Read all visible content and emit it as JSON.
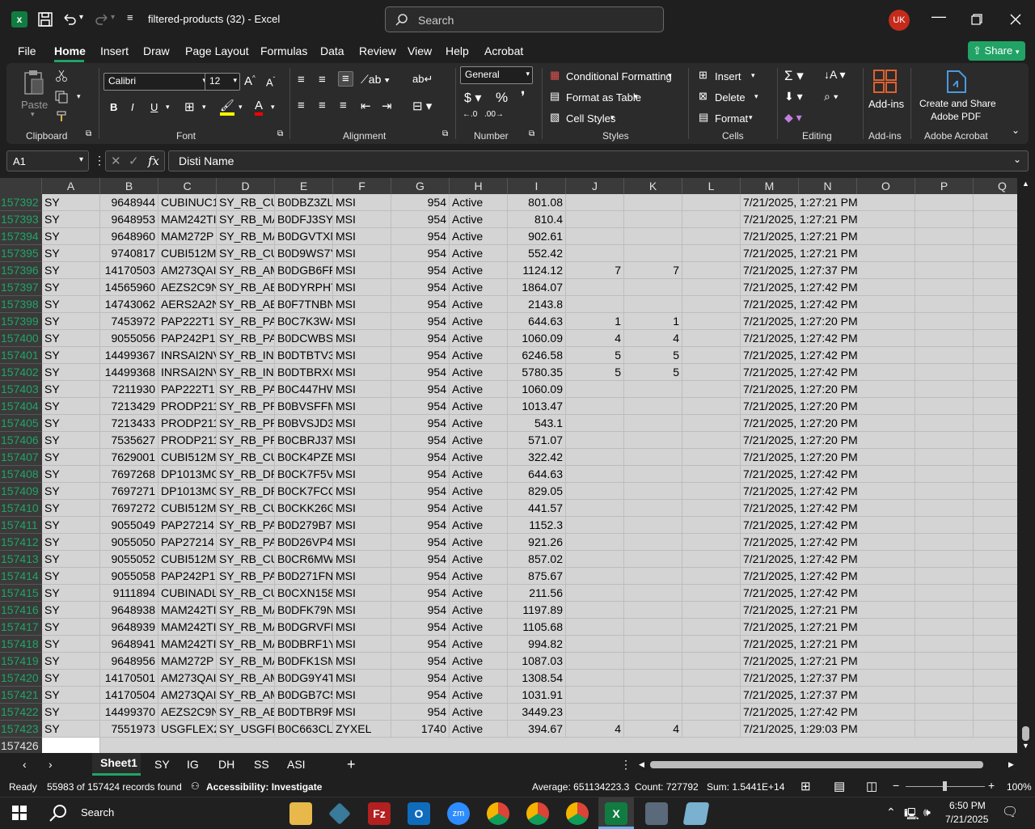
{
  "title_bar": {
    "doc_title": "filtered-products (32)  -  Excel",
    "search_placeholder": "Search",
    "avatar_initials": "UK"
  },
  "menu": [
    "File",
    "Home",
    "Insert",
    "Draw",
    "Page Layout",
    "Formulas",
    "Data",
    "Review",
    "View",
    "Help",
    "Acrobat"
  ],
  "share_label": "Share",
  "ribbon": {
    "clipboard": {
      "paste": "Paste",
      "label": "Clipboard"
    },
    "font": {
      "name": "Calibri",
      "size": "12",
      "label": "Font"
    },
    "alignment": {
      "label": "Alignment"
    },
    "number": {
      "format": "General",
      "label": "Number"
    },
    "styles": {
      "conditional": "Conditional Formatting",
      "format_table": "Format as Table",
      "cell_styles": "Cell Styles",
      "label": "Styles"
    },
    "cells": {
      "insert": "Insert",
      "delete": "Delete",
      "format": "Format",
      "label": "Cells"
    },
    "editing": {
      "label": "Editing"
    },
    "addins": {
      "button": "Add-ins",
      "label": "Add-ins"
    },
    "acrobat": {
      "button_line1": "Create and Share",
      "button_line2": "Adobe PDF",
      "label": "Adobe Acrobat"
    }
  },
  "formula_bar": {
    "name_box": "A1",
    "fx": "fx",
    "content": "Disti Name"
  },
  "columns": [
    "A",
    "B",
    "C",
    "D",
    "E",
    "F",
    "G",
    "H",
    "I",
    "J",
    "K",
    "L",
    "M",
    "N",
    "O",
    "P",
    "Q"
  ],
  "rows": [
    {
      "n": "157392",
      "a": "SY",
      "b": "9648944",
      "c": "CUBINUC1",
      "d": "SY_RB_CU",
      "e": "B0DBZ3ZL",
      "f": "MSI",
      "g": "954",
      "h": "Active",
      "i": "801.08",
      "j": "",
      "k": "",
      "m": "7/21/2025, 1:27:21 PM"
    },
    {
      "n": "157393",
      "a": "SY",
      "b": "9648953",
      "c": "MAM242TI",
      "d": "SY_RB_MA",
      "e": "B0DFJ3SYJ",
      "f": "MSI",
      "g": "954",
      "h": "Active",
      "i": "810.4",
      "j": "",
      "k": "",
      "m": "7/21/2025, 1:27:21 PM"
    },
    {
      "n": "157394",
      "a": "SY",
      "b": "9648960",
      "c": "MAM272P",
      "d": "SY_RB_MA",
      "e": "B0DGVTXN",
      "f": "MSI",
      "g": "954",
      "h": "Active",
      "i": "902.61",
      "j": "",
      "k": "",
      "m": "7/21/2025, 1:27:21 PM"
    },
    {
      "n": "157395",
      "a": "SY",
      "b": "9740817",
      "c": "CUBI512M",
      "d": "SY_RB_CU",
      "e": "B0D9WS7Y",
      "f": "MSI",
      "g": "954",
      "h": "Active",
      "i": "552.42",
      "j": "",
      "k": "",
      "m": "7/21/2025, 1:27:21 PM"
    },
    {
      "n": "157396",
      "a": "SY",
      "b": "14170503",
      "c": "AM273QAI",
      "d": "SY_RB_AM",
      "e": "B0DGB6FP",
      "f": "MSI",
      "g": "954",
      "h": "Active",
      "i": "1124.12",
      "j": "7",
      "k": "7",
      "m": "7/21/2025, 1:27:37 PM"
    },
    {
      "n": "157397",
      "a": "SY",
      "b": "14565960",
      "c": "AEZS2C9N",
      "d": "SY_RB_AE",
      "e": "B0DYRPHT",
      "f": "MSI",
      "g": "954",
      "h": "Active",
      "i": "1864.07",
      "j": "",
      "k": "",
      "m": "7/21/2025, 1:27:42 PM"
    },
    {
      "n": "157398",
      "a": "SY",
      "b": "14743062",
      "c": "AERS2A2N",
      "d": "SY_RB_AEI",
      "e": "B0F7TNBN",
      "f": "MSI",
      "g": "954",
      "h": "Active",
      "i": "2143.8",
      "j": "",
      "k": "",
      "m": "7/21/2025, 1:27:42 PM"
    },
    {
      "n": "157399",
      "a": "SY",
      "b": "7453972",
      "c": "PAP222T1",
      "d": "SY_RB_PAI",
      "e": "B0C7K3W4",
      "f": "MSI",
      "g": "954",
      "h": "Active",
      "i": "644.63",
      "j": "1",
      "k": "1",
      "m": "7/21/2025, 1:27:20 PM"
    },
    {
      "n": "157400",
      "a": "SY",
      "b": "9055056",
      "c": "PAP242P1",
      "d": "SY_RB_PAI",
      "e": "B0DCWBSJ",
      "f": "MSI",
      "g": "954",
      "h": "Active",
      "i": "1060.09",
      "j": "4",
      "k": "4",
      "m": "7/21/2025, 1:27:42 PM"
    },
    {
      "n": "157401",
      "a": "SY",
      "b": "14499367",
      "c": "INRSAI2NV",
      "d": "SY_RB_INF",
      "e": "B0DTBTV3",
      "f": "MSI",
      "g": "954",
      "h": "Active",
      "i": "6246.58",
      "j": "5",
      "k": "5",
      "m": "7/21/2025, 1:27:42 PM"
    },
    {
      "n": "157402",
      "a": "SY",
      "b": "14499368",
      "c": "INRSAI2NV",
      "d": "SY_RB_INF",
      "e": "B0DTBRXC",
      "f": "MSI",
      "g": "954",
      "h": "Active",
      "i": "5780.35",
      "j": "5",
      "k": "5",
      "m": "7/21/2025, 1:27:42 PM"
    },
    {
      "n": "157403",
      "a": "SY",
      "b": "7211930",
      "c": "PAP222T1",
      "d": "SY_RB_PAI",
      "e": "B0C447HW",
      "f": "MSI",
      "g": "954",
      "h": "Active",
      "i": "1060.09",
      "j": "",
      "k": "",
      "m": "7/21/2025, 1:27:20 PM"
    },
    {
      "n": "157404",
      "a": "SY",
      "b": "7213429",
      "c": "PRODP211",
      "d": "SY_RB_PR",
      "e": "B0BVSFFM",
      "f": "MSI",
      "g": "954",
      "h": "Active",
      "i": "1013.47",
      "j": "",
      "k": "",
      "m": "7/21/2025, 1:27:20 PM"
    },
    {
      "n": "157405",
      "a": "SY",
      "b": "7213433",
      "c": "PRODP211",
      "d": "SY_RB_PR",
      "e": "B0BVSJD3",
      "f": "MSI",
      "g": "954",
      "h": "Active",
      "i": "543.1",
      "j": "",
      "k": "",
      "m": "7/21/2025, 1:27:20 PM"
    },
    {
      "n": "157406",
      "a": "SY",
      "b": "7535627",
      "c": "PRODP211",
      "d": "SY_RB_PR",
      "e": "B0CBRJ37",
      "f": "MSI",
      "g": "954",
      "h": "Active",
      "i": "571.07",
      "j": "",
      "k": "",
      "m": "7/21/2025, 1:27:20 PM"
    },
    {
      "n": "157407",
      "a": "SY",
      "b": "7629001",
      "c": "CUBI512M",
      "d": "SY_RB_CU",
      "e": "B0CK4PZB",
      "f": "MSI",
      "g": "954",
      "h": "Active",
      "i": "322.42",
      "j": "",
      "k": "",
      "m": "7/21/2025, 1:27:20 PM"
    },
    {
      "n": "157408",
      "a": "SY",
      "b": "7697268",
      "c": "DP1013MC",
      "d": "SY_RB_DP",
      "e": "B0CK7F5V",
      "f": "MSI",
      "g": "954",
      "h": "Active",
      "i": "644.63",
      "j": "",
      "k": "",
      "m": "7/21/2025, 1:27:42 PM"
    },
    {
      "n": "157409",
      "a": "SY",
      "b": "7697271",
      "c": "DP1013MC",
      "d": "SY_RB_DP",
      "e": "B0CK7FCQ",
      "f": "MSI",
      "g": "954",
      "h": "Active",
      "i": "829.05",
      "j": "",
      "k": "",
      "m": "7/21/2025, 1:27:42 PM"
    },
    {
      "n": "157410",
      "a": "SY",
      "b": "7697272",
      "c": "CUBI512M",
      "d": "SY_RB_CU",
      "e": "B0CKK26G",
      "f": "MSI",
      "g": "954",
      "h": "Active",
      "i": "441.57",
      "j": "",
      "k": "",
      "m": "7/21/2025, 1:27:42 PM"
    },
    {
      "n": "157411",
      "a": "SY",
      "b": "9055049",
      "c": "PAP27214",
      "d": "SY_RB_PAI",
      "e": "B0D279B7",
      "f": "MSI",
      "g": "954",
      "h": "Active",
      "i": "1152.3",
      "j": "",
      "k": "",
      "m": "7/21/2025, 1:27:42 PM"
    },
    {
      "n": "157412",
      "a": "SY",
      "b": "9055050",
      "c": "PAP27214",
      "d": "SY_RB_PAI",
      "e": "B0D26VP4",
      "f": "MSI",
      "g": "954",
      "h": "Active",
      "i": "921.26",
      "j": "",
      "k": "",
      "m": "7/21/2025, 1:27:42 PM"
    },
    {
      "n": "157413",
      "a": "SY",
      "b": "9055052",
      "c": "CUBI512M",
      "d": "SY_RB_CU",
      "e": "B0CR6MW",
      "f": "MSI",
      "g": "954",
      "h": "Active",
      "i": "857.02",
      "j": "",
      "k": "",
      "m": "7/21/2025, 1:27:42 PM"
    },
    {
      "n": "157414",
      "a": "SY",
      "b": "9055058",
      "c": "PAP242P1",
      "d": "SY_RB_PAI",
      "e": "B0D271FN",
      "f": "MSI",
      "g": "954",
      "h": "Active",
      "i": "875.67",
      "j": "",
      "k": "",
      "m": "7/21/2025, 1:27:42 PM"
    },
    {
      "n": "157415",
      "a": "SY",
      "b": "9111894",
      "c": "CUBINADL",
      "d": "SY_RB_CU",
      "e": "B0CXN158",
      "f": "MSI",
      "g": "954",
      "h": "Active",
      "i": "211.56",
      "j": "",
      "k": "",
      "m": "7/21/2025, 1:27:42 PM"
    },
    {
      "n": "157416",
      "a": "SY",
      "b": "9648938",
      "c": "MAM242TI",
      "d": "SY_RB_MA",
      "e": "B0DFK79N",
      "f": "MSI",
      "g": "954",
      "h": "Active",
      "i": "1197.89",
      "j": "",
      "k": "",
      "m": "7/21/2025, 1:27:21 PM"
    },
    {
      "n": "157417",
      "a": "SY",
      "b": "9648939",
      "c": "MAM242TI",
      "d": "SY_RB_MA",
      "e": "B0DGRVFE",
      "f": "MSI",
      "g": "954",
      "h": "Active",
      "i": "1105.68",
      "j": "",
      "k": "",
      "m": "7/21/2025, 1:27:21 PM"
    },
    {
      "n": "157418",
      "a": "SY",
      "b": "9648941",
      "c": "MAM242TI",
      "d": "SY_RB_MA",
      "e": "B0DBRF1Y",
      "f": "MSI",
      "g": "954",
      "h": "Active",
      "i": "994.82",
      "j": "",
      "k": "",
      "m": "7/21/2025, 1:27:21 PM"
    },
    {
      "n": "157419",
      "a": "SY",
      "b": "9648956",
      "c": "MAM272P",
      "d": "SY_RB_MA",
      "e": "B0DFK1SM",
      "f": "MSI",
      "g": "954",
      "h": "Active",
      "i": "1087.03",
      "j": "",
      "k": "",
      "m": "7/21/2025, 1:27:21 PM"
    },
    {
      "n": "157420",
      "a": "SY",
      "b": "14170501",
      "c": "AM273QAI",
      "d": "SY_RB_AM",
      "e": "B0DG9Y4T",
      "f": "MSI",
      "g": "954",
      "h": "Active",
      "i": "1308.54",
      "j": "",
      "k": "",
      "m": "7/21/2025, 1:27:37 PM"
    },
    {
      "n": "157421",
      "a": "SY",
      "b": "14170504",
      "c": "AM273QAI",
      "d": "SY_RB_AM",
      "e": "B0DGB7C5",
      "f": "MSI",
      "g": "954",
      "h": "Active",
      "i": "1031.91",
      "j": "",
      "k": "",
      "m": "7/21/2025, 1:27:37 PM"
    },
    {
      "n": "157422",
      "a": "SY",
      "b": "14499370",
      "c": "AEZS2C9N",
      "d": "SY_RB_AE",
      "e": "B0DTBR9P",
      "f": "MSI",
      "g": "954",
      "h": "Active",
      "i": "3449.23",
      "j": "",
      "k": "",
      "m": "7/21/2025, 1:27:42 PM"
    },
    {
      "n": "157423",
      "a": "SY",
      "b": "7551973",
      "c": "USGFLEX2",
      "d": "SY_USGFLE",
      "e": "B0C663CL",
      "f": "ZYXEL",
      "g": "1740",
      "h": "Active",
      "i": "394.67",
      "j": "4",
      "k": "4",
      "m": "7/21/2025, 1:29:03 PM"
    }
  ],
  "last_row_header": "157426",
  "sheets": [
    "Sheet1",
    "SY",
    "IG",
    "DH",
    "SS",
    "ASI"
  ],
  "status": {
    "ready": "Ready",
    "records": "55983 of 157424 records found",
    "accessibility": "Accessibility: Investigate",
    "average": "Average: 651134223.3",
    "count": "Count: 727792",
    "sum": "Sum: 1.5441E+14",
    "zoom": "100%"
  },
  "taskbar": {
    "search": "Search",
    "time": "6:50 PM",
    "date": "7/21/2025"
  },
  "colors": {
    "excel_green": "#21a366",
    "accent_red": "#c42b1c"
  }
}
